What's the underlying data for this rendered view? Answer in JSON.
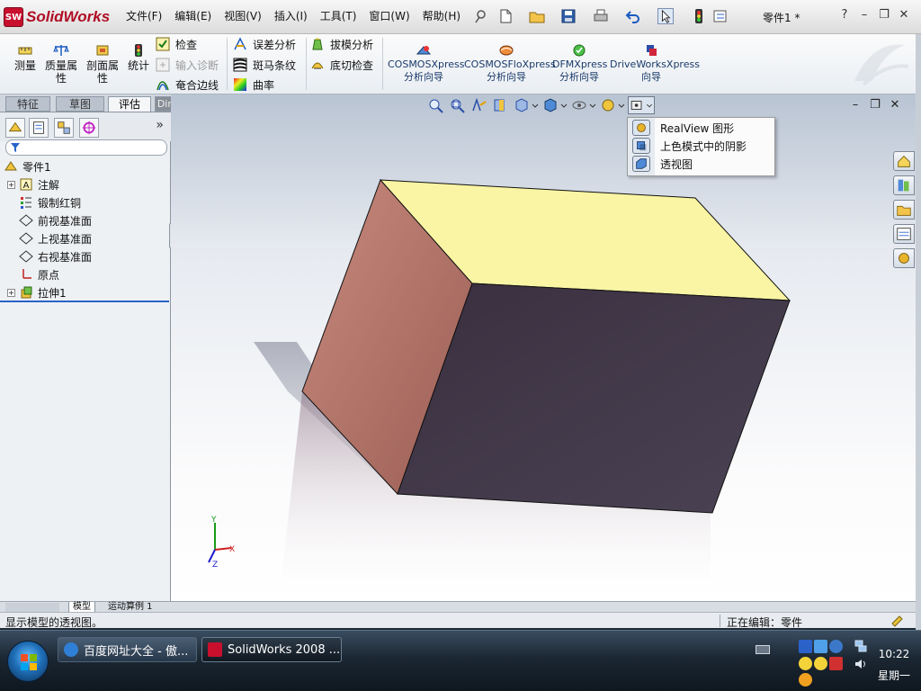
{
  "app": {
    "name": "SolidWorks",
    "logo_mark": "SW",
    "document_title": "零件1 *"
  },
  "menu": [
    "文件(F)",
    "编辑(E)",
    "视图(V)",
    "插入(I)",
    "工具(T)",
    "窗口(W)",
    "帮助(H)"
  ],
  "title_controls": [
    "?",
    "–",
    "❐",
    "✕"
  ],
  "ribbon": {
    "measure": "测量",
    "mass_props_1": "质量属",
    "mass_props_2": "性",
    "section_props_1": "剖面属",
    "section_props_2": "性",
    "statistics": "统计",
    "check": "检查",
    "import_diag": "输入诊断",
    "coincident_edges": "奄合边线",
    "deviation": "误差分析",
    "zebra": "斑马条纹",
    "curvature": "曲率",
    "draft": "拔模分析",
    "undercut": "底切检查",
    "xpress": [
      {
        "line1": "COSMOSXpress",
        "line2": "分析向导"
      },
      {
        "line1": "COSMOSFloXpress",
        "line2": "分析向导"
      },
      {
        "line1": "DFMXpress",
        "line2": "分析向导"
      },
      {
        "line1": "DriveWorksXpress",
        "line2": "向导"
      }
    ]
  },
  "tabs": {
    "features": "特征",
    "sketch": "草图",
    "evaluate": "评估",
    "dimxpert": "DimXpert"
  },
  "feature_tree": {
    "root": "零件1",
    "items": [
      {
        "label": "注解",
        "expandable": true,
        "icon": "annotations-icon"
      },
      {
        "label": "锻制红铜",
        "expandable": false,
        "icon": "material-icon"
      },
      {
        "label": "前视基准面",
        "expandable": false,
        "icon": "plane-icon"
      },
      {
        "label": "上视基准面",
        "expandable": false,
        "icon": "plane-icon"
      },
      {
        "label": "右视基准面",
        "expandable": false,
        "icon": "plane-icon"
      },
      {
        "label": "原点",
        "expandable": false,
        "icon": "origin-icon"
      },
      {
        "label": "拉伸1",
        "expandable": true,
        "icon": "extrude-icon"
      }
    ],
    "more_glyph": "»"
  },
  "graphics_controls": [
    "–",
    "❐",
    "✕"
  ],
  "dropdown": {
    "items": [
      {
        "label": "RealView 图形",
        "icon": "realview-icon"
      },
      {
        "label": "上色模式中的阴影",
        "icon": "shadows-icon"
      },
      {
        "label": "透视图",
        "icon": "perspective-icon"
      }
    ]
  },
  "triad": {
    "x": "X",
    "y": "Y",
    "z": "Z"
  },
  "model_tabs": {
    "model": "模型",
    "motion": "运动算例 1"
  },
  "status": {
    "hint": "显示模型的透视图。",
    "editing": "正在编辑：零件"
  },
  "taskbar": {
    "tasks": [
      {
        "label": "百度网址大全 - 傲...",
        "active": false
      },
      {
        "label": "SolidWorks 2008 ...",
        "active": true
      }
    ],
    "time": "10:22",
    "day": "星期一"
  },
  "colors": {
    "brand_red": "#c8102e",
    "box_top": "#f9f5a4",
    "box_front": "#3c3140",
    "box_side": "#b07266",
    "selection_blue": "#2a62c9"
  }
}
